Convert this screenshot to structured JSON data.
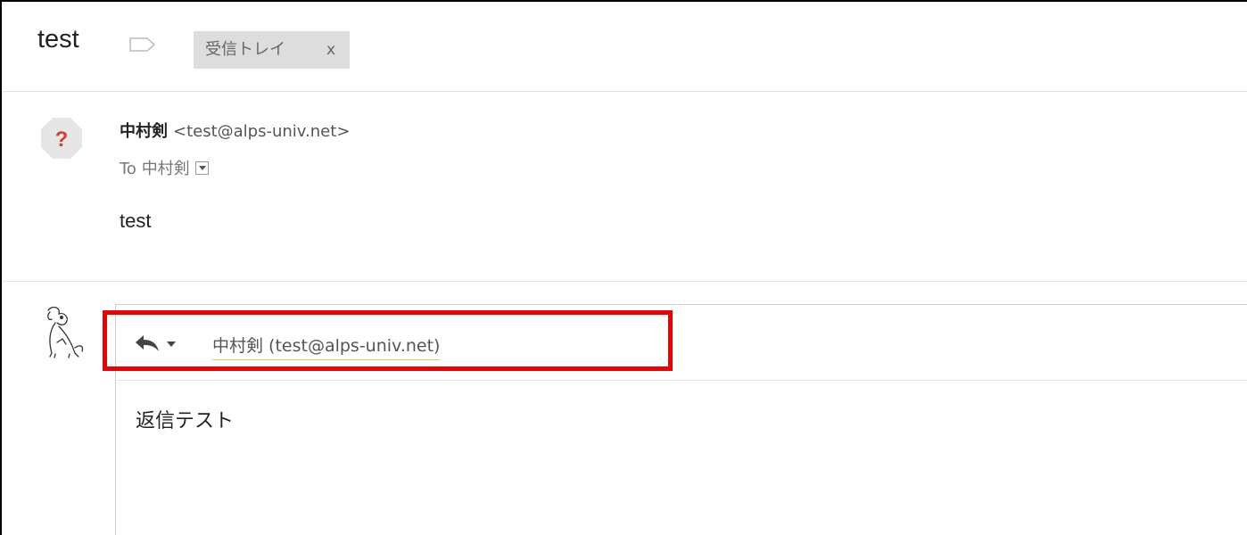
{
  "thread": {
    "subject": "test",
    "label_chip": "受信トレイ",
    "label_chip_close": "x"
  },
  "message": {
    "sender_name": "中村剣",
    "sender_email": "<test@alps-univ.net>",
    "to_prefix": "To",
    "to_name": "中村剣",
    "body": "test",
    "avatar_icon": "question-mark-avatar-icon"
  },
  "reply": {
    "recipient": "中村剣 (test@alps-univ.net)",
    "body": "返信テスト",
    "avatar_icon": "dog-sketch-avatar-icon",
    "action_icon": "reply-arrow-icon"
  },
  "colors": {
    "highlight": "#ee0000",
    "avatar_question": "#d23f31",
    "recipient_underline": "#f2c94c"
  }
}
